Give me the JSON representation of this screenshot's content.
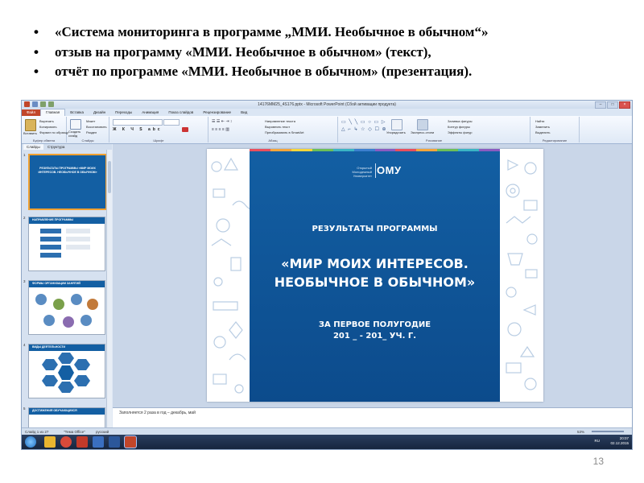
{
  "slide": {
    "bullets": [
      "«Система мониторинга в программе „ММИ. Необычное в обычном“»",
      "отзыв на программу «ММИ. Необычное в обычном» (текст),",
      "отчёт по программе «ММИ. Необычное в обычном» (презентация)."
    ],
    "page_number": "13"
  },
  "ppt": {
    "window_title": "14176MM25_4S176.pptx - Microsoft PowerPoint (Сбой активации продукта)",
    "tabs": [
      "Файл",
      "Главная",
      "Вставка",
      "Дизайн",
      "Переходы",
      "Анимация",
      "Показ слайдов",
      "Рецензирование",
      "Вид"
    ],
    "active_tab": "Главная",
    "ribbon_groups": [
      "Буфер обмена",
      "Слайды",
      "Шрифт",
      "Абзац",
      "Рисование",
      "Редактирование"
    ],
    "ribbon_items": {
      "paste": "Вставить",
      "cut": "Вырезать",
      "copy": "Копировать",
      "format_painter": "Формат по образцу",
      "create_slide": "Создать слайд",
      "layout": "Макет",
      "reset": "Восстановить",
      "section": "Раздел",
      "text_direction": "Направление текста",
      "align_text": "Выровнять текст",
      "smartart": "Преобразовать в SmartArt",
      "arrange": "Упорядочить",
      "quick_styles": "Экспресс-стили",
      "shape_fill": "Заливка фигуры",
      "shape_outline": "Контур фигуры",
      "shape_effects": "Эффекты фигур",
      "find": "Найти",
      "replace": "Заменить",
      "select": "Выделить"
    },
    "pane_tabs": [
      "Слайды",
      "Структура"
    ],
    "thumbnails": [
      {
        "num": "1",
        "title": "РЕЗУЛЬТАТЫ ПРОГРАММЫ «МИР МОИХ ИНТЕРЕСОВ. НЕОБЫЧНОЕ В ОБЫЧНОМ»"
      },
      {
        "num": "2",
        "title": "НАПРАВЛЕНИЕ ПРОГРАММЫ"
      },
      {
        "num": "3",
        "title": "ФОРМЫ ОРГАНИЗАЦИИ ЗАНЯТИЙ"
      },
      {
        "num": "4",
        "title": "ВИДЫ ДЕЯТЕЛЬНОСТИ"
      },
      {
        "num": "5",
        "title": "ДОСТИЖЕНИЯ ОБУЧАЮЩИХСЯ"
      }
    ],
    "main_slide": {
      "logo_small": "Открытый Молодежный Университет",
      "logo": "ОМУ",
      "heading": "РЕЗУЛЬТАТЫ ПРОГРАММЫ",
      "title_line1": "«МИР МОИХ ИНТЕРЕСОВ.",
      "title_line2": "НЕОБЫЧНОЕ В ОБЫЧНОМ»",
      "period_line1": "ЗА ПЕРВОЕ ПОЛУГОДИЕ",
      "period_line2": "201 _ - 201_ УЧ. Г."
    },
    "notes": "Заполняется 2 раза в год – декабрь, май",
    "status": {
      "slide": "Слайд 1 из 27",
      "theme": "\"Тема Office\"",
      "language": "русский",
      "zoom": "53%"
    },
    "taskbar": {
      "lang": "RU",
      "time": "20:07",
      "date": "02.12.2015"
    }
  },
  "colors": {
    "slide_blue": "#135fa3",
    "ribbon": "#dfe9f6",
    "file_tab": "#c1462a",
    "taskbar": "#1f3150"
  }
}
